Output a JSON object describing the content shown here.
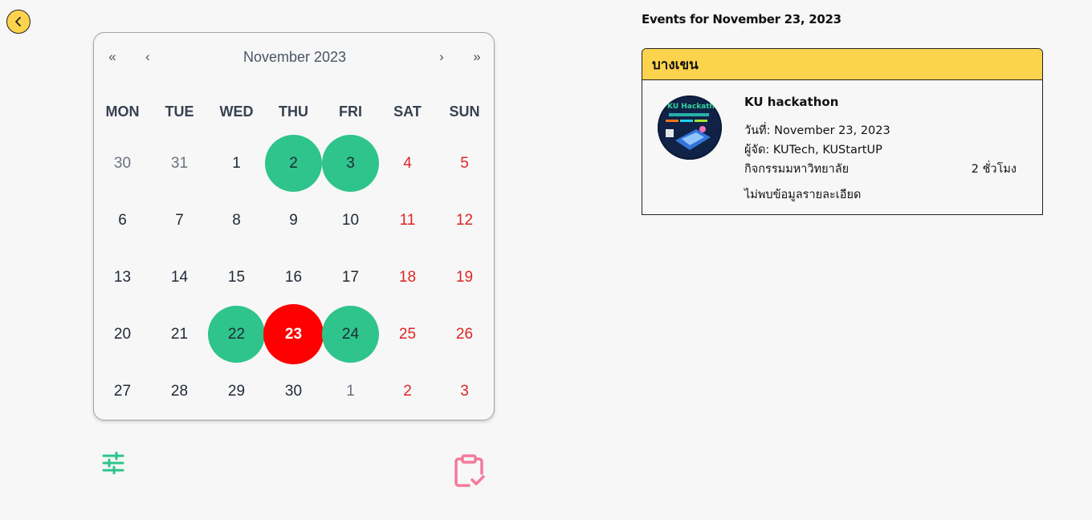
{
  "calendar": {
    "nav": {
      "prev_year": "«",
      "prev_month": "‹",
      "month_label": "November 2023",
      "next_month": "›",
      "next_year": "»"
    },
    "weekdays": [
      "MON",
      "TUE",
      "WED",
      "THU",
      "FRI",
      "SAT",
      "SUN"
    ],
    "weeks": [
      [
        {
          "d": "30",
          "out": true
        },
        {
          "d": "31",
          "out": true
        },
        {
          "d": "1"
        },
        {
          "d": "2",
          "event": true
        },
        {
          "d": "3",
          "event": true
        },
        {
          "d": "4",
          "we": true
        },
        {
          "d": "5",
          "we": true
        }
      ],
      [
        {
          "d": "6"
        },
        {
          "d": "7"
        },
        {
          "d": "8"
        },
        {
          "d": "9"
        },
        {
          "d": "10"
        },
        {
          "d": "11",
          "we": true
        },
        {
          "d": "12",
          "we": true
        }
      ],
      [
        {
          "d": "13"
        },
        {
          "d": "14"
        },
        {
          "d": "15"
        },
        {
          "d": "16"
        },
        {
          "d": "17"
        },
        {
          "d": "18",
          "we": true
        },
        {
          "d": "19",
          "we": true
        }
      ],
      [
        {
          "d": "20"
        },
        {
          "d": "21"
        },
        {
          "d": "22",
          "event": true
        },
        {
          "d": "23",
          "selected": true
        },
        {
          "d": "24",
          "event": true
        },
        {
          "d": "25",
          "we": true
        },
        {
          "d": "26",
          "we": true
        }
      ],
      [
        {
          "d": "27"
        },
        {
          "d": "28"
        },
        {
          "d": "29"
        },
        {
          "d": "30"
        },
        {
          "d": "1",
          "out": true
        },
        {
          "d": "2",
          "we": true
        },
        {
          "d": "3",
          "we": true
        }
      ]
    ]
  },
  "events": {
    "heading": "Events for November 23, 2023",
    "campus": "บางเขน",
    "items": [
      {
        "title": "KU hackathon",
        "date_line": "วันที่: November 23, 2023",
        "organizer_line": "ผู้จัด: KUTech, KUStartUP",
        "category": "กิจกรรมมหาวิทยาลัย",
        "duration": "2 ชั่วโมง",
        "details": "ไม่พบข้อมูลรายละเอียด",
        "thumb_text": "KU Hackathon"
      }
    ]
  },
  "colors": {
    "accent_yellow": "#fcd34d",
    "event_green": "#2ec48b",
    "selected_red": "#ff0000",
    "weekend_red": "#dc2626",
    "filter_icon": "#2ec48b",
    "clipboard_icon": "#f47a9b"
  },
  "icons": {
    "back": "chevron-left-icon",
    "filter": "sliders-icon",
    "clipboard": "clipboard-check-icon"
  }
}
